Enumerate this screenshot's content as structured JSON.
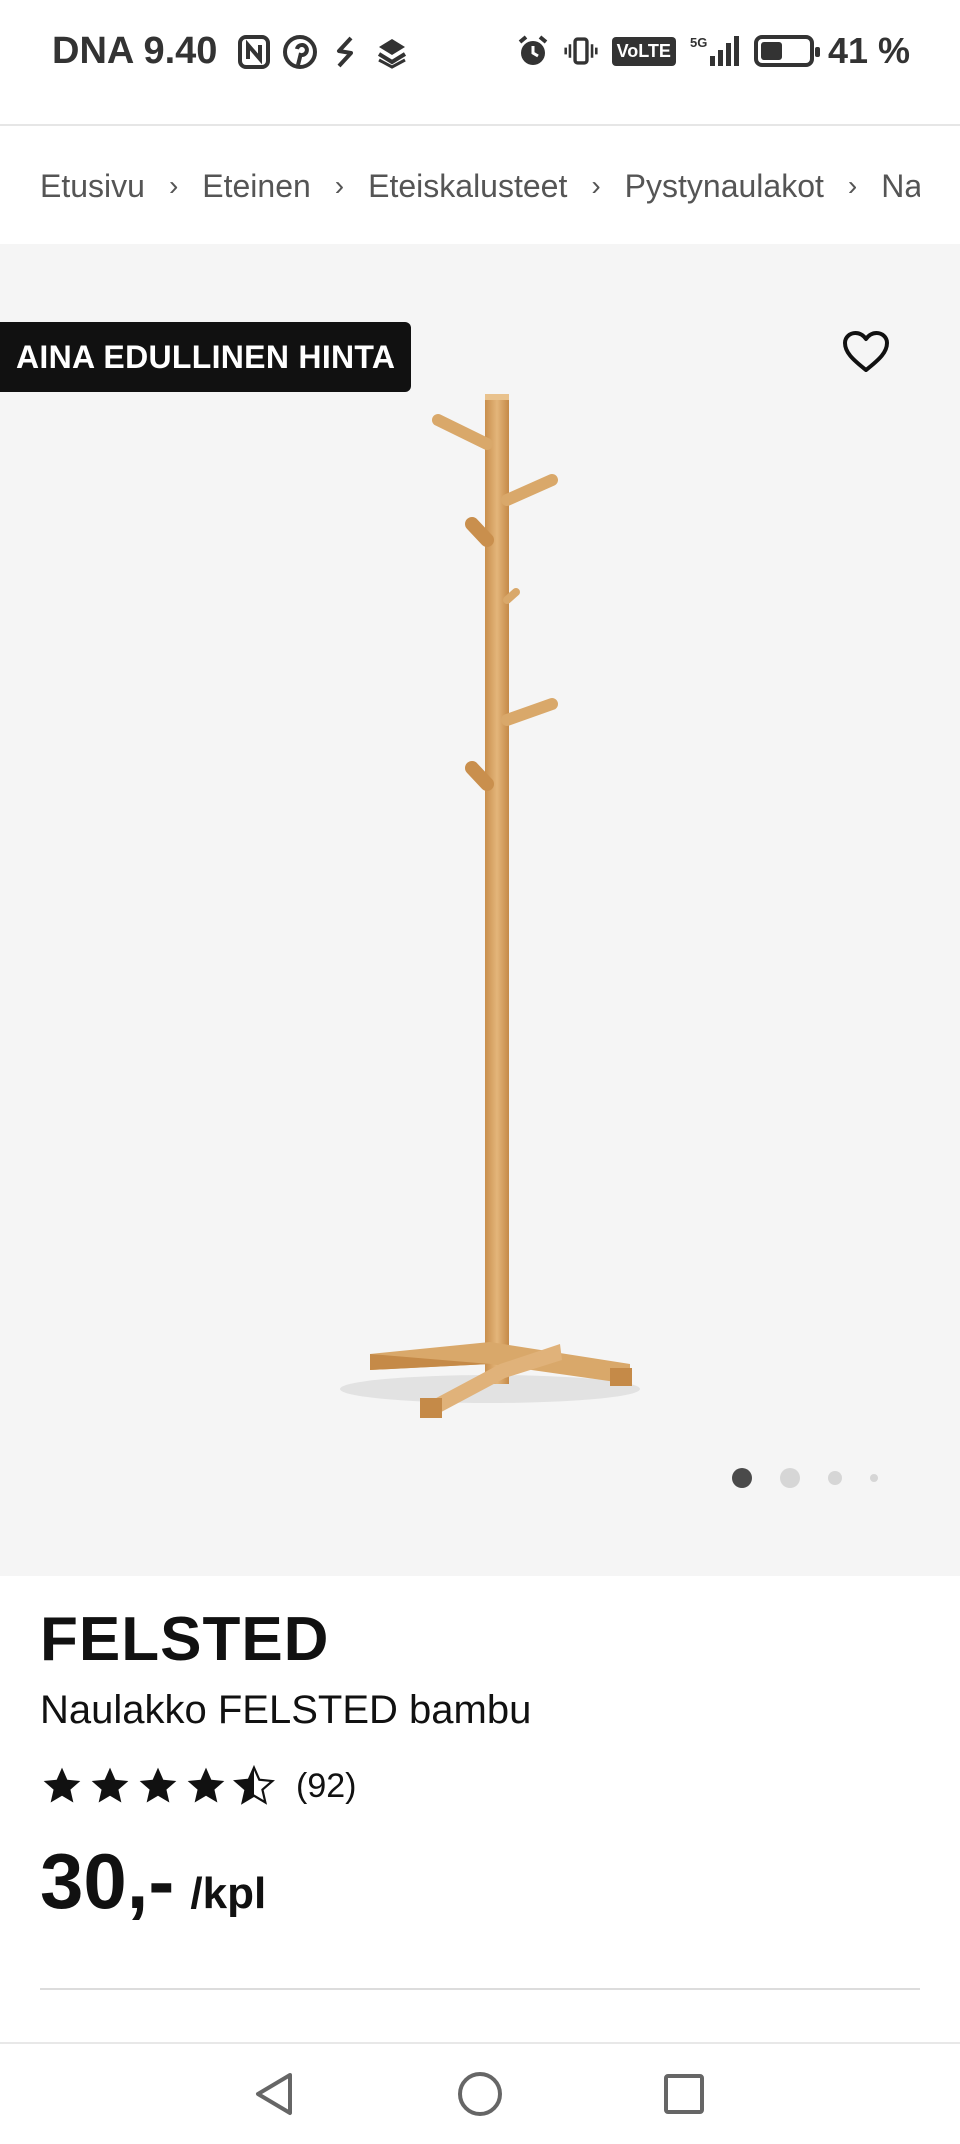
{
  "status_bar": {
    "carrier_time": "DNA 9.40",
    "battery_text": "41 %",
    "battery_level_percent": 41,
    "volte_label": "VoLTE",
    "network_label": "5G",
    "icons_left": [
      "nfc-icon",
      "pinterest-icon",
      "shazam-icon",
      "stack-app-icon"
    ],
    "icons_right": [
      "alarm-icon",
      "vibrate-icon",
      "volte-icon",
      "signal-icon",
      "battery-icon"
    ]
  },
  "breadcrumb": {
    "items": [
      "Etusivu",
      "Eteinen",
      "Eteiskalusteet",
      "Pystynaulakot",
      "Naulakot"
    ],
    "separator": "›"
  },
  "hero": {
    "badge": "AINA EDULLINEN HINTA",
    "favorite_icon": "heart-outline-icon",
    "carousel_dots": 4,
    "active_dot": 0
  },
  "product": {
    "name": "FELSTED",
    "description": "Naulakko FELSTED bambu",
    "rating_value": 4.5,
    "rating_max": 5,
    "rating_count": "(92)",
    "price": "30,-",
    "unit": "/kpl"
  },
  "nav_bar": {
    "buttons": [
      "back-triangle-icon",
      "home-circle-icon",
      "recents-square-icon"
    ]
  },
  "colors": {
    "hero_bg": "#f5f5f5",
    "badge_bg": "#111111",
    "wood": "#d9a86a"
  }
}
